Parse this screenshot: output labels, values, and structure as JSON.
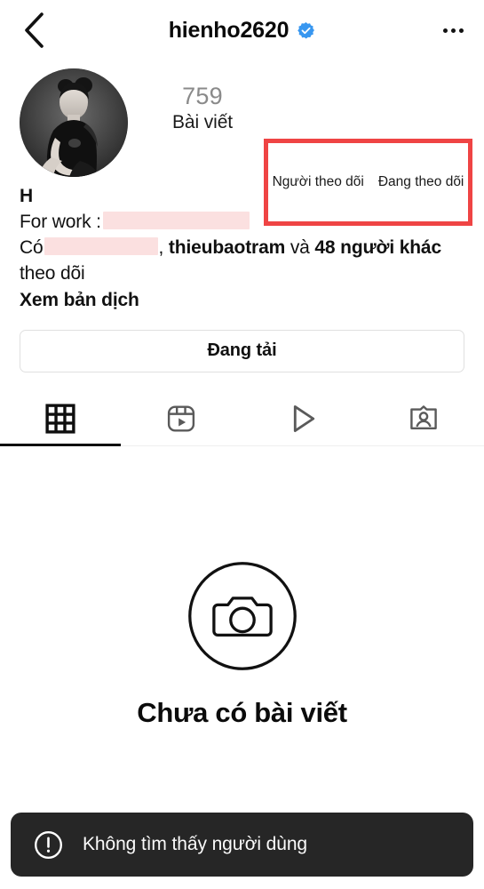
{
  "header": {
    "back_icon": "chevron-left-icon",
    "username": "hienho2620",
    "verified_icon": "verified-badge-icon",
    "menu_icon": "more-options-icon"
  },
  "profile": {
    "avatar_alt": "profile-photo",
    "stats": {
      "posts": {
        "count": "759",
        "label": "Bài viết"
      },
      "followers": {
        "count": "",
        "label": "Người theo dõi"
      },
      "following": {
        "count": "",
        "label": "Đang theo dõi"
      }
    },
    "annotation": {
      "color": "#ef4444"
    },
    "bio": {
      "name": "H",
      "work_line_prefix": "For work :",
      "followed_by_prefix": "Có",
      "followed_by_separator": ",",
      "followed_by_user": "thieubaotram",
      "followed_by_conjunction": "và",
      "followed_by_others": "48 người khác",
      "followed_by_suffix": "theo dõi",
      "see_translation": "Xem bản dịch",
      "redaction_color": "#fbe0e0"
    },
    "action_button": "Đang tải"
  },
  "tabs": [
    {
      "name": "grid-tab",
      "icon": "grid-icon",
      "active": true
    },
    {
      "name": "reels-tab",
      "icon": "reels-icon",
      "active": false
    },
    {
      "name": "igtv-tab",
      "icon": "play-icon",
      "active": false
    },
    {
      "name": "tagged-tab",
      "icon": "tagged-person-icon",
      "active": false
    }
  ],
  "empty_state": {
    "icon": "camera-circle-icon",
    "title": "Chưa có bài viết"
  },
  "toast": {
    "icon": "exclamation-circle-icon",
    "message": "Không tìm thấy người dùng",
    "background": "#262626"
  }
}
